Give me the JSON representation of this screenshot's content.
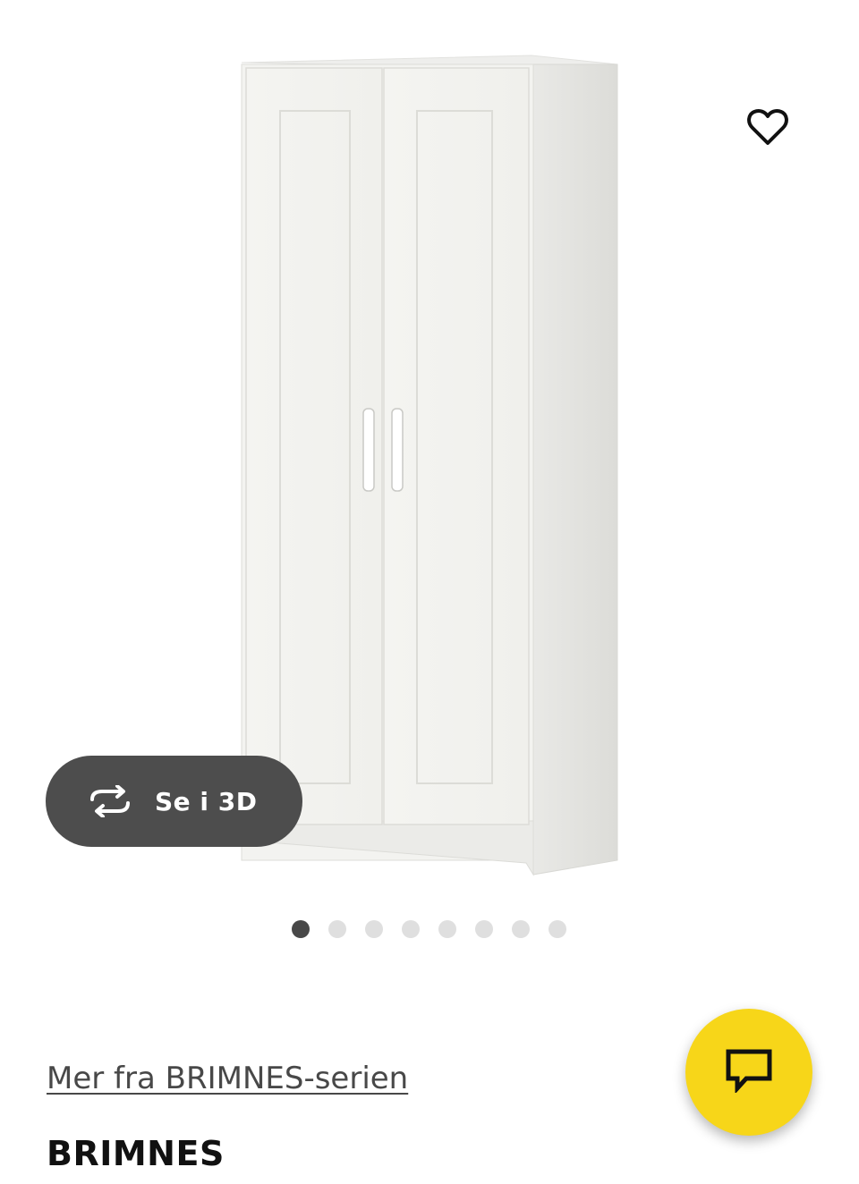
{
  "view_3d": {
    "label": "Se i 3D",
    "icon": "rotate-icon"
  },
  "favorite": {
    "icon": "heart-icon"
  },
  "carousel": {
    "total": 8,
    "active_index": 0
  },
  "series_link": {
    "label": "Mer fra BRIMNES-serien"
  },
  "product": {
    "name": "BRIMNES"
  },
  "chat": {
    "icon": "chat-icon"
  },
  "colors": {
    "chat_button": "#f7d619",
    "pill_background": "#4d4d4d",
    "dot_active": "#484848",
    "dot_inactive": "#dfdfdf",
    "link_text": "#484848"
  }
}
